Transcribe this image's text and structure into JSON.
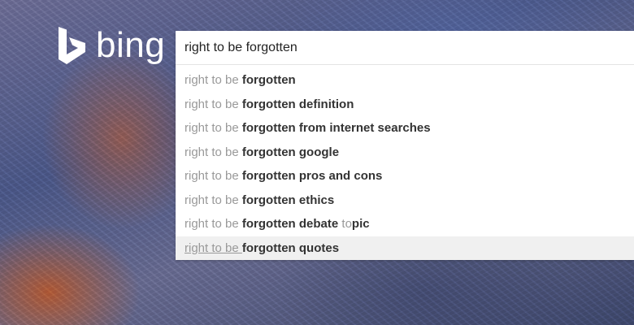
{
  "logo": {
    "text": "bing",
    "icon": "bing-logo-icon"
  },
  "search": {
    "value": "right to be forgotten"
  },
  "suggestions": [
    {
      "prefix": "right to be ",
      "bold": "forgotten",
      "rest": ""
    },
    {
      "prefix": "right to be ",
      "bold": "forgotten definition",
      "rest": ""
    },
    {
      "prefix": "right to be ",
      "bold": "forgotten from internet searches",
      "rest": ""
    },
    {
      "prefix": "right to be ",
      "bold": "forgotten google",
      "rest": ""
    },
    {
      "prefix": "right to be ",
      "bold": "forgotten pros and cons",
      "rest": ""
    },
    {
      "prefix": "right to be ",
      "bold": "forgotten ethics",
      "rest": ""
    },
    {
      "prefix": "right to be ",
      "bold": "forgotten debate",
      "rest": " to",
      "tail": "pic"
    },
    {
      "prefix": "right to be ",
      "bold": "forgotten quotes",
      "rest": ""
    }
  ],
  "colors": {
    "brand": "#ffffff",
    "suggestion_prefix": "#999999",
    "suggestion_bold": "#333333",
    "selected_bg": "#f0f0f0"
  }
}
